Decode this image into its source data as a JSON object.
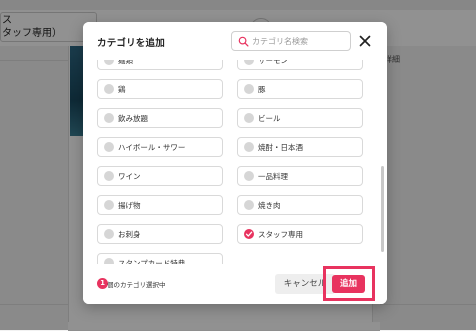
{
  "background": {
    "left_field_text": "ス\nタッフ専用）",
    "right_panel_label": "詳細"
  },
  "modal": {
    "title": "カテゴリを追加",
    "search": {
      "placeholder": "カテゴリ名検索",
      "value": ""
    },
    "close_icon": "close-icon",
    "categories": [
      {
        "label": "麺類",
        "checked": false
      },
      {
        "label": "サーモン",
        "checked": false
      },
      {
        "label": "鶏",
        "checked": false
      },
      {
        "label": "豚",
        "checked": false
      },
      {
        "label": "飲み放題",
        "checked": false
      },
      {
        "label": "ビール",
        "checked": false
      },
      {
        "label": "ハイボール・サワー",
        "checked": false
      },
      {
        "label": "焼酎・日本酒",
        "checked": false
      },
      {
        "label": "ワイン",
        "checked": false
      },
      {
        "label": "一品料理",
        "checked": false
      },
      {
        "label": "揚げ物",
        "checked": false
      },
      {
        "label": "焼き肉",
        "checked": false
      },
      {
        "label": "お刺身",
        "checked": false
      },
      {
        "label": "スタッフ専用",
        "checked": true
      },
      {
        "label": "スタンプカード特典",
        "checked": false
      }
    ],
    "footer": {
      "selected_count": "1",
      "selected_text": "個のカテゴリ選択中",
      "cancel_label": "キャンセル",
      "add_label": "追加"
    }
  },
  "colors": {
    "accent": "#e8335f",
    "overlay": "rgba(0,0,0,0.43)"
  }
}
